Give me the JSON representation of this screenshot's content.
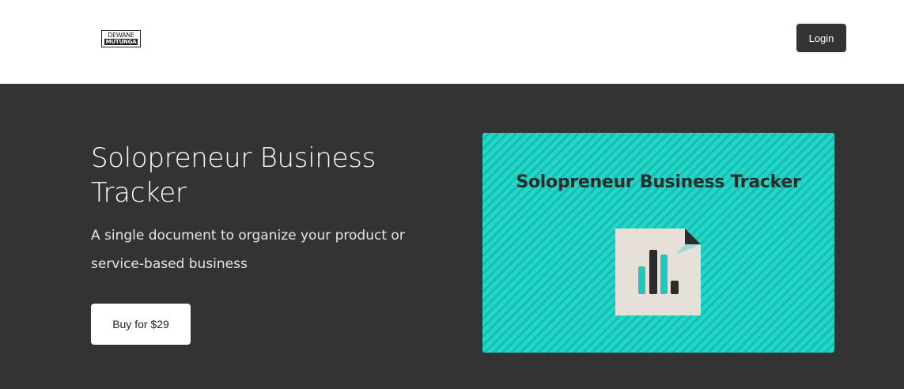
{
  "header": {
    "logo": {
      "line1": "DEWANE",
      "line2": "MUTUNGA"
    },
    "login_label": "Login"
  },
  "hero": {
    "title": "Solopreneur Business Tracker",
    "subtitle": "A single document to organize your product or service-based business",
    "buy_label": "Buy for $29"
  },
  "cover": {
    "title": "Solopreneur Business Tracker",
    "icon": "document-bar-chart-icon",
    "colors": {
      "background": "#23d6c8",
      "stripe": "#14bfb2",
      "paper": "#e6e0d9",
      "bar_teal": "#1fc8bb",
      "bar_dark": "#2b2b2b"
    }
  },
  "colors": {
    "header_bg": "#ffffff",
    "hero_bg": "#333333",
    "button_dark": "#333333"
  }
}
